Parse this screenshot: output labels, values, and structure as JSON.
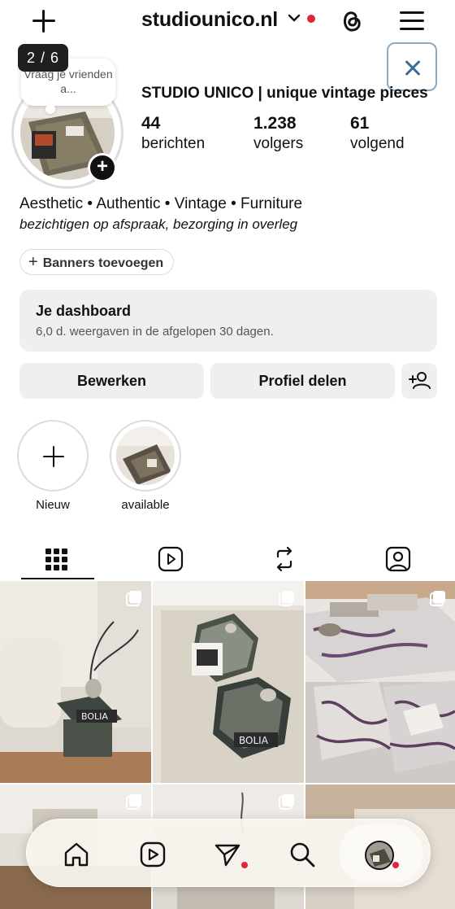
{
  "header": {
    "username": "studiounico.nl"
  },
  "story": {
    "pager": "2 / 6",
    "note_placeholder": "Vraag je vrienden a..."
  },
  "profile": {
    "display_name": "STUDIO UNICO | unique vintage pieces",
    "stats": [
      {
        "value": "44",
        "label": "berichten"
      },
      {
        "value": "1.238",
        "label": "volgers"
      },
      {
        "value": "61",
        "label": "volgend"
      }
    ],
    "bio_line1": "Aesthetic • Authentic • Vintage • Furniture",
    "bio_line2": "bezichtigen op afspraak, bezorging in overleg",
    "banner_button": "Banners toevoegen"
  },
  "dashboard": {
    "title": "Je dashboard",
    "subtitle": "6,0 d. weergaven in de afgelopen 30 dagen."
  },
  "actions": {
    "edit": "Bewerken",
    "share": "Profiel delen"
  },
  "highlights": [
    {
      "label": "Nieuw"
    },
    {
      "label": "available"
    }
  ],
  "tabs": [
    {
      "icon": "grid-icon"
    },
    {
      "icon": "reels-icon"
    },
    {
      "icon": "reposts-icon"
    },
    {
      "icon": "tagged-icon"
    }
  ],
  "grid_texts": {
    "post1_brand": "BOLIA",
    "post2_brand": "BOLIA"
  },
  "bottom_nav": [
    {
      "icon": "home-icon"
    },
    {
      "icon": "reels-icon"
    },
    {
      "icon": "direct-message-icon"
    },
    {
      "icon": "search-icon"
    },
    {
      "icon": "profile-avatar"
    }
  ],
  "colors": {
    "accent_red": "#e0243c",
    "button_bg": "#efefef",
    "close_blue": "#3c6d96"
  }
}
